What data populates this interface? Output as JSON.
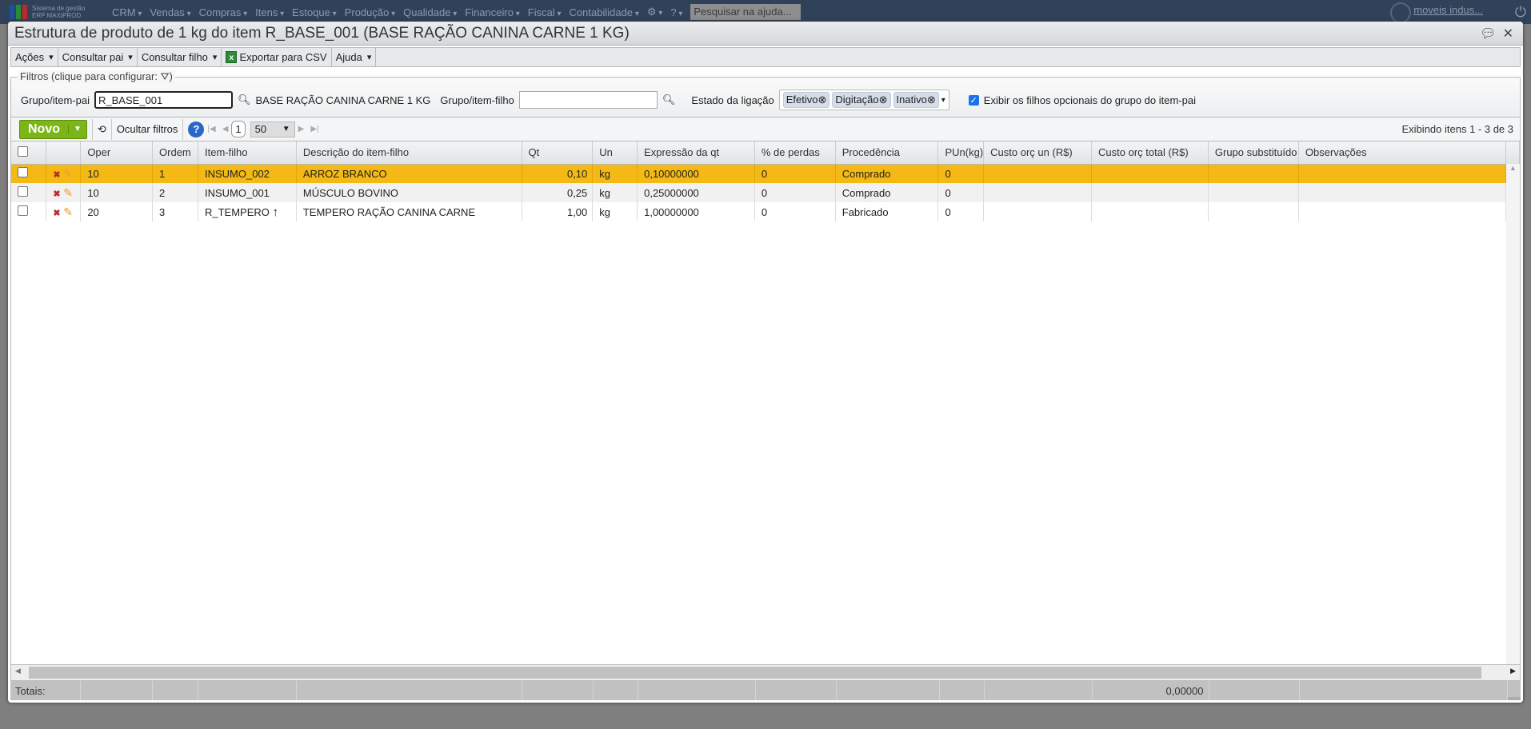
{
  "topnav": {
    "logo_text": [
      "Sistema de gestão",
      "ERP MAXIPROD"
    ],
    "items": [
      "CRM",
      "Vendas",
      "Compras",
      "Itens",
      "Estoque",
      "Produção",
      "Qualidade",
      "Financeiro",
      "Fiscal",
      "Contabilidade"
    ],
    "help_search": "Pesquisar na ajuda...",
    "user": "moveis indus..."
  },
  "window": {
    "title": "Estrutura de produto de 1 kg do item R_BASE_001 (BASE RAÇÃO CANINA CARNE 1 KG)"
  },
  "toolbar": {
    "acoes": "Ações",
    "consultar_pai": "Consultar pai",
    "consultar_filho": "Consultar filho",
    "exportar": "Exportar para CSV",
    "ajuda": "Ajuda"
  },
  "filters": {
    "legend": "Filtros (clique para configurar:",
    "legend_end": ")",
    "parent_label": "Grupo/item-pai",
    "parent_value": "R_BASE_001",
    "parent_desc": "BASE RAÇÃO CANINA CARNE 1 KG",
    "child_label": "Grupo/item-filho",
    "child_value": "",
    "state_label": "Estado da ligação",
    "states": [
      "Efetivo",
      "Digitação",
      "Inativo"
    ],
    "optional_label": "Exibir os filhos opcionais do grupo do item-pai",
    "optional_checked": true
  },
  "gridbar": {
    "novo": "Novo",
    "hide_filters": "Ocultar filtros",
    "page": "1",
    "page_size": "50",
    "status": "Exibindo itens 1 - 3 de 3"
  },
  "columns": [
    "Oper",
    "Ordem",
    "Item-filho",
    "Descrição do item-filho",
    "Qt",
    "Un",
    "Expressão da qt",
    "% de perdas",
    "Procedência",
    "PUn(kg)",
    "Custo orç un (R$)",
    "Custo orç total (R$)",
    "Grupo substituído",
    "Observações"
  ],
  "rows": [
    {
      "oper": "10",
      "ordem": "1",
      "item": "INSUMO_002",
      "desc": "ARROZ BRANCO",
      "qt": "0,10",
      "un": "kg",
      "expr": "0,10000000",
      "perdas": "0",
      "proc": "Comprado",
      "pun": "0",
      "selected": true
    },
    {
      "oper": "10",
      "ordem": "2",
      "item": "INSUMO_001",
      "desc": "MÚSCULO BOVINO",
      "qt": "0,25",
      "un": "kg",
      "expr": "0,25000000",
      "perdas": "0",
      "proc": "Comprado",
      "pun": "0"
    },
    {
      "oper": "20",
      "ordem": "3",
      "item": "R_TEMPERO",
      "desc": "TEMPERO RAÇÃO CANINA CARNE",
      "qt": "1,00",
      "un": "kg",
      "expr": "1,00000000",
      "perdas": "0",
      "proc": "Fabricado",
      "pun": "0",
      "has_link": true
    }
  ],
  "totals": {
    "label": "Totais:",
    "custo_total": "0,00000"
  }
}
